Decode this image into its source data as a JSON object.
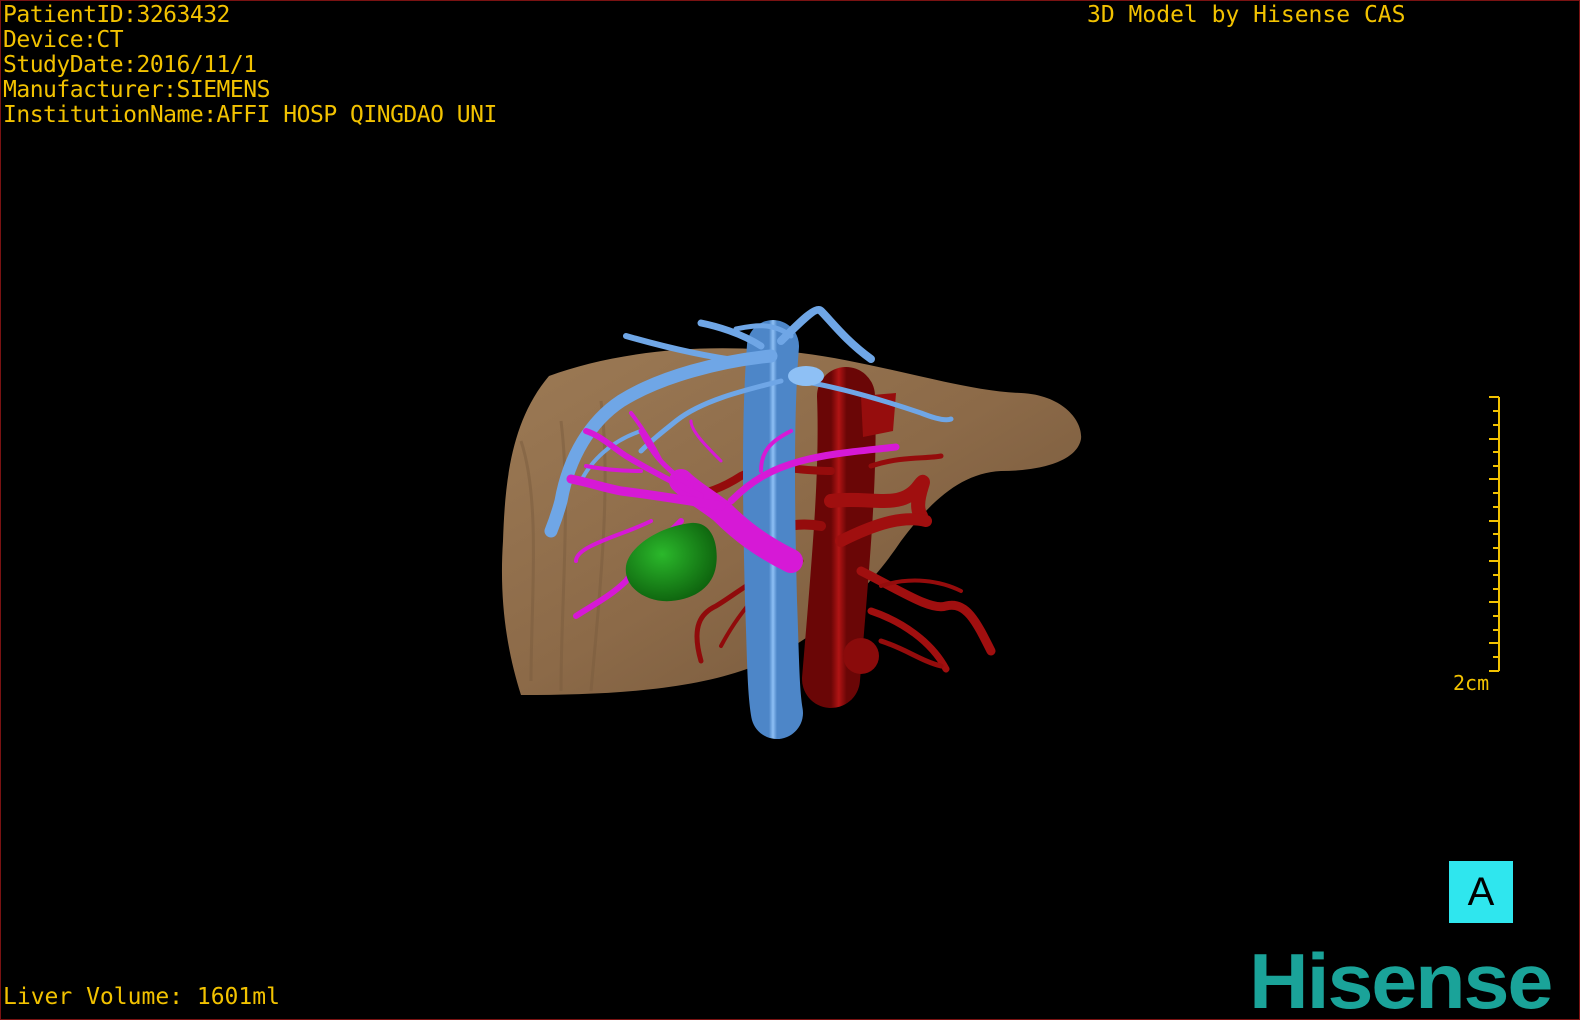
{
  "dicom": {
    "patient_id": "PatientID:3263432",
    "device": "Device:CT",
    "study_date": "StudyDate:2016/11/1",
    "manufacturer": "Manufacturer:SIEMENS",
    "institution": "InstitutionName:AFFI HOSP QINGDAO UNI"
  },
  "credit": "3D Model by Hisense CAS",
  "liver_volume": "Liver Volume: 1601ml",
  "scale_bar": {
    "label": "2cm"
  },
  "orientation": "A",
  "brand": "Hisense",
  "colors": {
    "text": "#f2c200",
    "liver": "#8c6a48",
    "hepatic_vein": "#6fa6e6",
    "portal_vein": "#d619d6",
    "artery": "#960d0d",
    "lesion": "#138a13",
    "orientation_badge": "#2fe6ee",
    "brand": "#1aa399",
    "frame": "#7a1212"
  },
  "structures": [
    "liver",
    "hepatic-vein",
    "portal-vein",
    "hepatic-artery",
    "lesion"
  ]
}
